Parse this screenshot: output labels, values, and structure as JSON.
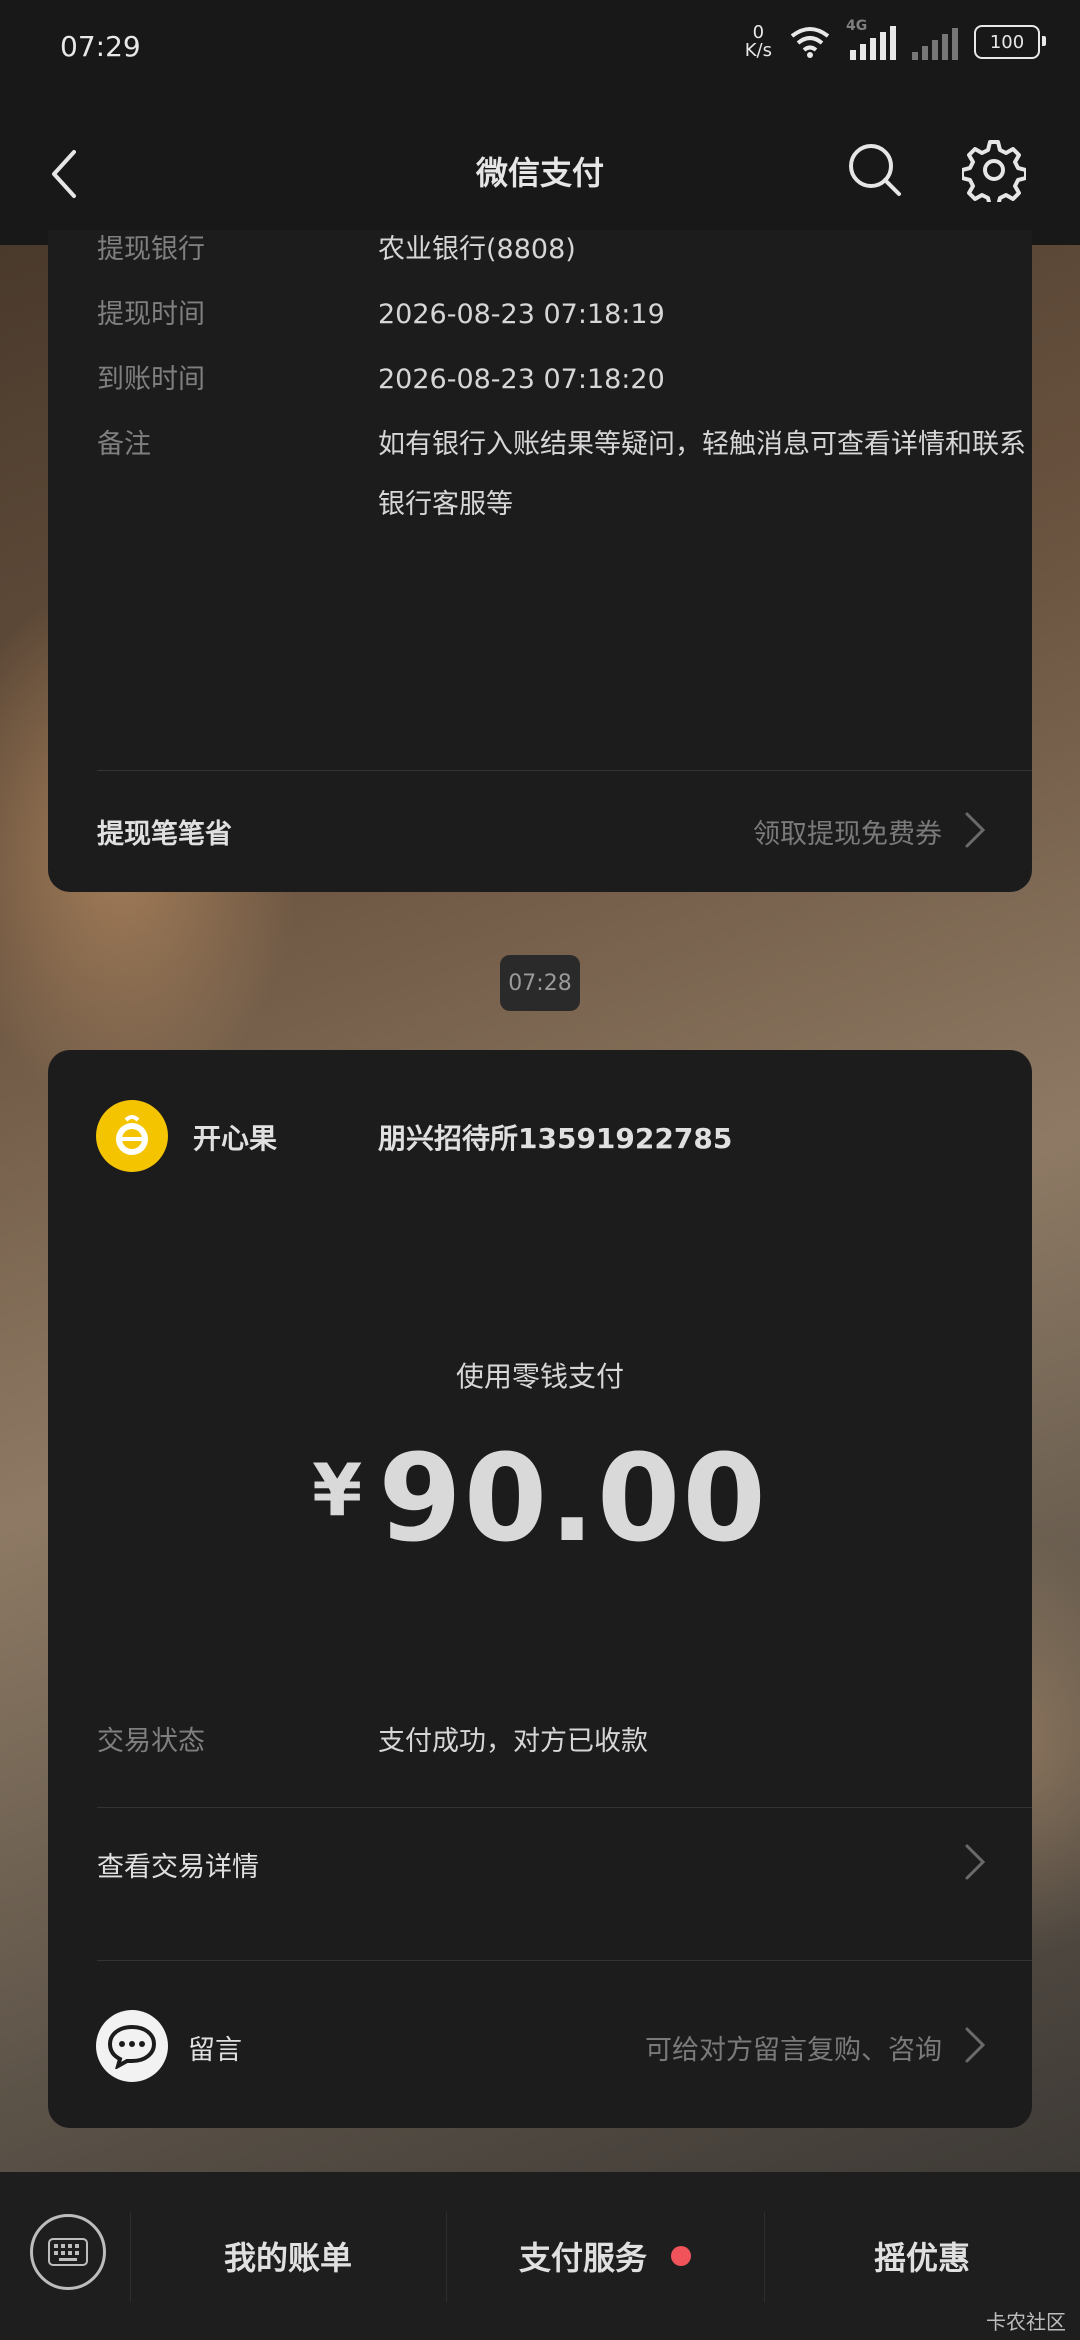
{
  "status_bar": {
    "time": "07:29",
    "net_speed_value": "0",
    "net_speed_unit": "K/s",
    "network_label": "4G",
    "battery": "100"
  },
  "header": {
    "title": "微信支付"
  },
  "withdraw_card": {
    "rows": [
      {
        "label": "提现银行",
        "value": "农业银行(8808)"
      },
      {
        "label": "提现时间",
        "value": "2026-08-23  07:18:19"
      },
      {
        "label": "到账时间",
        "value": "2026-08-23  07:18:20"
      },
      {
        "label": "备注",
        "value": "如有银行入账结果等疑问，轻触消息可查看详情和联系银行客服等"
      }
    ],
    "footer_label": "提现笔笔省",
    "footer_action": "领取提现免费券"
  },
  "message_time": "07:28",
  "payment_card": {
    "merchant_name": "开心果",
    "merchant_store": "朋兴招待所13591922785",
    "pay_method": "使用零钱支付",
    "currency_symbol": "¥",
    "amount": "90.00",
    "status_label": "交易状态",
    "status_value": "支付成功，对方已收款",
    "details_label": "查看交易详情",
    "message_label": "留言",
    "message_hint": "可给对方留言复购、咨询"
  },
  "bottom_bar": {
    "tabs": [
      "我的账单",
      "支付服务",
      "摇优惠"
    ],
    "badge_color": "#f0545a"
  },
  "watermark": "卡农社区"
}
